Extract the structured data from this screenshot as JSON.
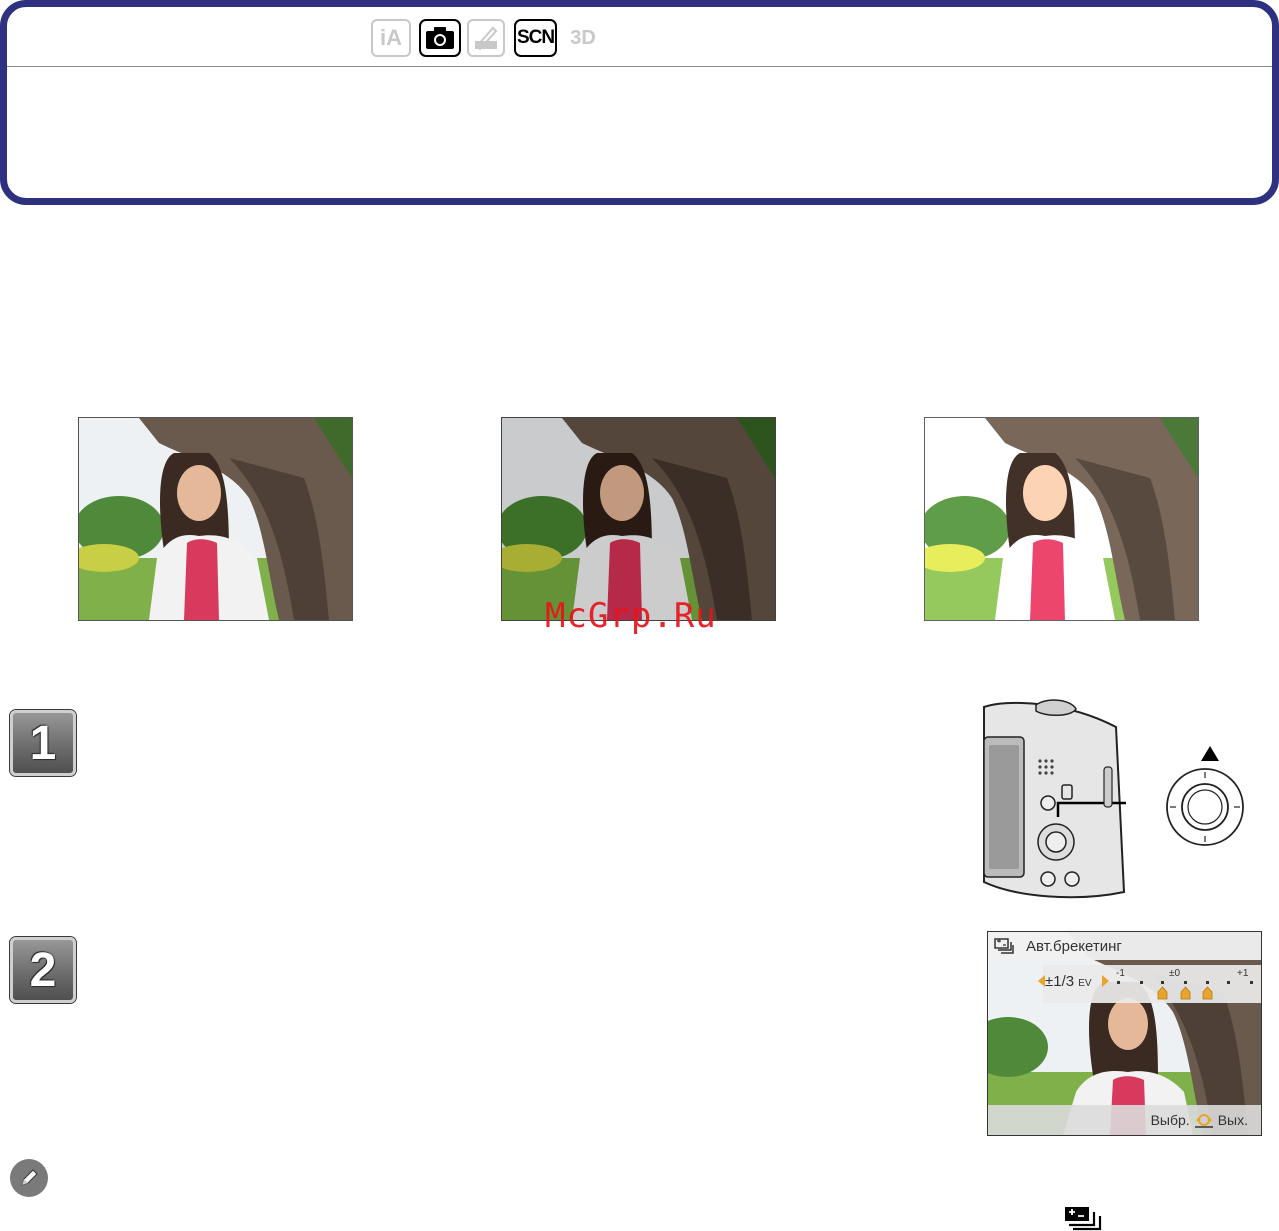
{
  "header": {
    "mode_icons": [
      {
        "name": "ia-mode-icon",
        "label": "iA",
        "active": false
      },
      {
        "name": "normal-picture-mode-icon",
        "label": "",
        "active": true
      },
      {
        "name": "mini-mode-icon",
        "label": "MINI",
        "active": false
      },
      {
        "name": "scene-mode-icon",
        "label": "SCN",
        "active": true
      },
      {
        "name": "3d-mode-icon",
        "label": "3D",
        "active": false
      }
    ]
  },
  "sample_photos": [
    {
      "name": "photo-normal-exposure",
      "exposure": "±0"
    },
    {
      "name": "photo-underexposed",
      "exposure": "-"
    },
    {
      "name": "photo-overexposed",
      "exposure": "+"
    }
  ],
  "watermark": "McGrp.Ru",
  "steps": [
    {
      "number": "1"
    },
    {
      "number": "2"
    }
  ],
  "lcd": {
    "title": "Авт.брекетинг",
    "ev_value": "±1/3",
    "ev_unit": "EV",
    "scale_labels": {
      "minus": "-1",
      "zero": "±0",
      "plus": "+1"
    },
    "select_label": "Выбр.",
    "exit_label": "Вых."
  },
  "colors": {
    "header_border": "#2e3180",
    "watermark": "#e8141a",
    "lcd_accent": "#e8a42c"
  }
}
